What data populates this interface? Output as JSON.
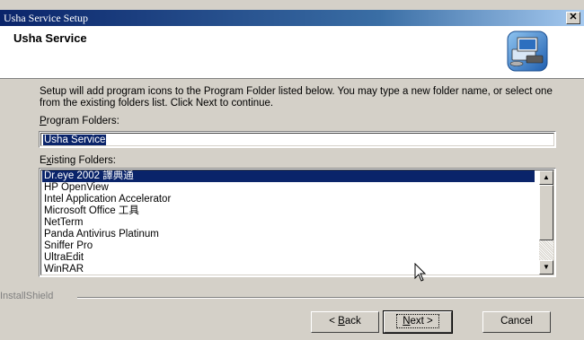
{
  "window": {
    "title": "Usha Service Setup",
    "close_label": "✕"
  },
  "header": {
    "title": "Usha Service",
    "icon": "install-computer-icon"
  },
  "description": "Setup will add program icons to the Program Folder listed below.  You may type a new folder name, or select one from the existing folders list.  Click Next to continue.",
  "program_folders": {
    "label_first": "P",
    "label_rest": "rogram Folders:",
    "value": "Usha Service"
  },
  "existing_folders": {
    "label_first": "E",
    "label_rest": "xisting Folders:",
    "items": [
      "Dr.eye 2002 譯典通",
      "HP OpenView",
      "Intel Application Accelerator",
      "Microsoft Office 工具",
      "NetTerm",
      "Panda Antivirus Platinum",
      "Sniffer Pro",
      "UltraEdit",
      "WinRAR"
    ],
    "selected_index": 0
  },
  "footer": {
    "brand": "InstallShield"
  },
  "buttons": {
    "back_prefix": "< ",
    "back_accel": "B",
    "back_rest": "ack",
    "next_accel": "N",
    "next_rest": "ext >",
    "cancel": "Cancel"
  },
  "colors": {
    "title_bar": "#0a246a",
    "selection": "#0a246a",
    "face": "#d4d0c8"
  }
}
